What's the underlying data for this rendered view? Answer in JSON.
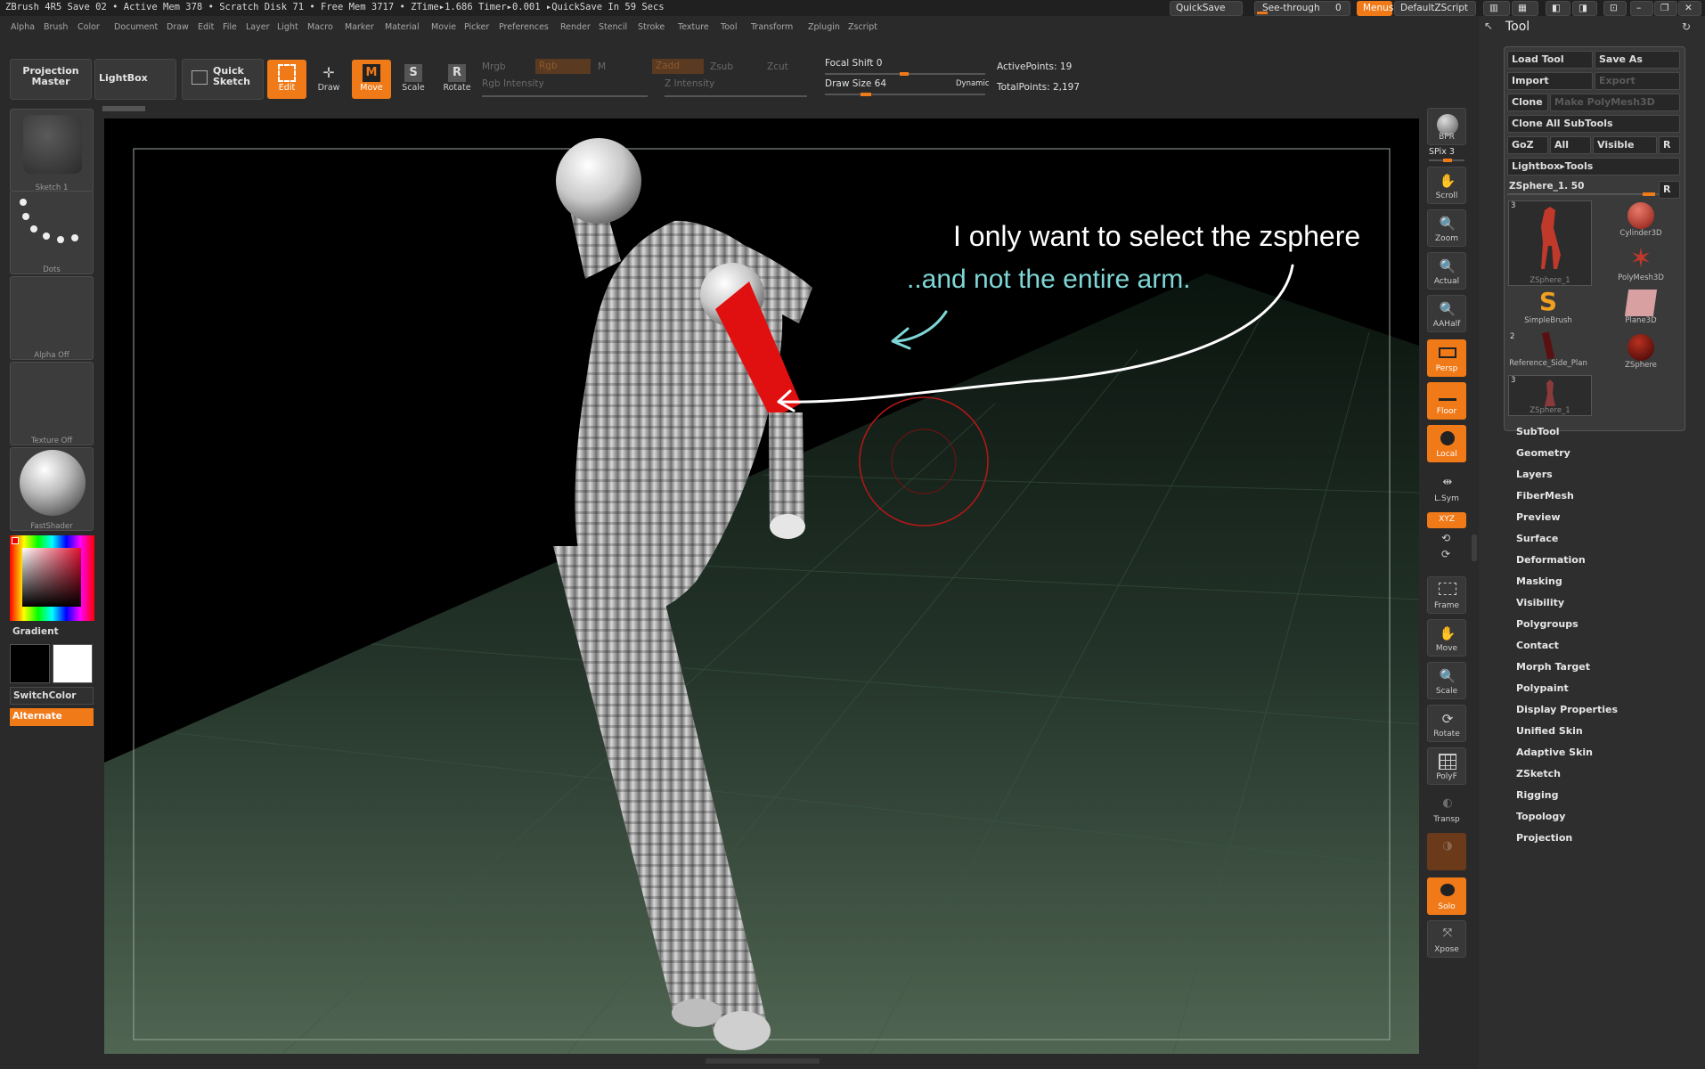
{
  "status_bar": {
    "text": "ZBrush 4R5    Save 02    • Active Mem 378  • Scratch Disk 71  • Free Mem 3717  • ZTime▸1.686  Timer▸0.001  ▸QuickSave In 59 Secs",
    "quicksave": "QuickSave",
    "see_through_label": "See-through",
    "see_through_value": "0",
    "menus": "Menus",
    "default_zscript": "DefaultZScript"
  },
  "menu_items": [
    "Alpha",
    "Brush",
    "Color",
    "Document",
    "Draw",
    "Edit",
    "File",
    "Layer",
    "Light",
    "Macro",
    "Marker",
    "Material",
    "Movie",
    "Picker",
    "Preferences",
    "Render",
    "Stencil",
    "Stroke",
    "Texture",
    "Tool",
    "Transform",
    "Zplugin",
    "Zscript"
  ],
  "shelf": {
    "projection_master": "Projection\nMaster",
    "lightbox": "LightBox",
    "quick_sketch": "Quick\nSketch",
    "edit": "Edit",
    "draw": "Draw",
    "move": "Move",
    "scale": "Scale",
    "rotate": "Rotate",
    "mrgb": "Mrgb",
    "rgb": "Rgb",
    "m": "M",
    "rgb_intensity": "Rgb Intensity",
    "zadd": "Zadd",
    "zsub": "Zsub",
    "zcut": "Zcut",
    "z_intensity": "Z Intensity",
    "focal_shift": "Focal Shift 0",
    "draw_size": "Draw Size 64",
    "dynamic": "Dynamic",
    "active_points": "ActivePoints: 19",
    "total_points": "TotalPoints: 2,197"
  },
  "left_panel": {
    "stroke_thumb": "Sketch 1",
    "dots_thumb": "Dots",
    "alpha_thumb": "Alpha Off",
    "texture_thumb": "Texture Off",
    "material_thumb": "FastShader",
    "gradient": "Gradient",
    "switchcolor": "SwitchColor",
    "alternate": "Alternate"
  },
  "annotations": {
    "line1": "I only want to select the zsphere",
    "line2": "..and not the entire arm."
  },
  "right_strip": [
    {
      "label": "BPR",
      "on": false
    },
    {
      "label": "Scroll",
      "on": false
    },
    {
      "label": "Zoom",
      "on": false
    },
    {
      "label": "Actual",
      "on": false
    },
    {
      "label": "AAHalf",
      "on": false
    },
    {
      "label": "Persp",
      "on": true
    },
    {
      "label": "Floor",
      "on": true
    },
    {
      "label": "Local",
      "on": true
    },
    {
      "label": "L.Sym",
      "on": false
    },
    {
      "label": "Frame",
      "on": false
    },
    {
      "label": "Move",
      "on": false
    },
    {
      "label": "Scale",
      "on": false
    },
    {
      "label": "Rotate",
      "on": false
    },
    {
      "label": "PolyF",
      "on": false
    },
    {
      "label": "Transp",
      "on": false
    },
    {
      "label": "Solo",
      "on": true
    },
    {
      "label": "Xpose",
      "on": false
    }
  ],
  "spix": "SPix 3",
  "xyz": "XYZ",
  "tool_panel": {
    "title": "Tool",
    "load_tool": "Load Tool",
    "save_as": "Save As",
    "import": "Import",
    "export": "Export",
    "clone": "Clone",
    "make_polymesh": "Make PolyMesh3D",
    "clone_all": "Clone All SubTools",
    "goz": "GoZ",
    "all": "All",
    "visible": "Visible",
    "r": "R",
    "lightbox_tools": "Lightbox▸Tools",
    "current_tool": "ZSphere_1. 50",
    "tools": [
      {
        "name": "ZSphere_1",
        "count": "3"
      },
      {
        "name": "Cylinder3D",
        "count": ""
      },
      {
        "name": "PolyMesh3D",
        "count": ""
      },
      {
        "name": "SimpleBrush",
        "count": ""
      },
      {
        "name": "Plane3D",
        "count": ""
      },
      {
        "name": "Reference_Side_Plan",
        "count": "2"
      },
      {
        "name": "ZSphere",
        "count": ""
      },
      {
        "name": "ZSphere_1",
        "count": "3"
      }
    ],
    "subpalettes": [
      "SubTool",
      "Geometry",
      "Layers",
      "FiberMesh",
      "Preview",
      "Surface",
      "Deformation",
      "Masking",
      "Visibility",
      "Polygroups",
      "Contact",
      "Morph Target",
      "Polypaint",
      "Display Properties",
      "Unified Skin",
      "Adaptive Skin",
      "ZSketch",
      "Rigging",
      "Topology",
      "Projection"
    ]
  },
  "colors": {
    "accent": "#f07a18",
    "annotation_white": "#ffffff",
    "annotation_cyan": "#7fd6d6",
    "selected_segment": "#e01010"
  }
}
